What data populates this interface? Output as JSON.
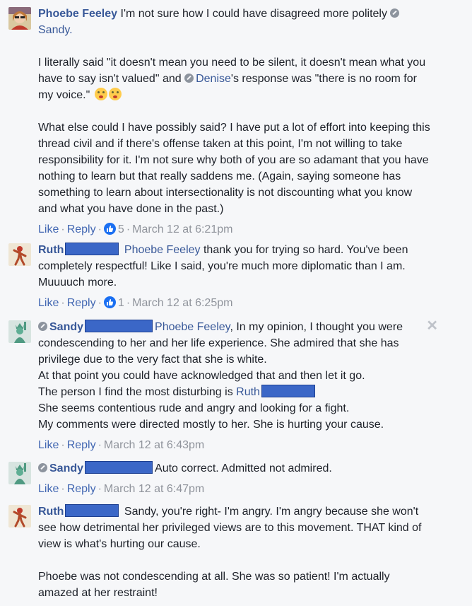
{
  "comments": [
    {
      "author": "Phoebe Feeley",
      "text1": "I'm not sure how I could have disagreed more politely",
      "mention1": "Sandy.",
      "para2_a": "I literally said \"it doesn't mean you need to be silent, it doesn't mean what you have to say isn't valued\" and",
      "mention2": "Denise",
      "para2_b": "'s response was \"there is no room for my voice.\"",
      "para3": "What else could I have possibly said? I have put a lot of effort into keeping this thread civil and if there's offense taken at this point, I'm not willing to take responsibility for it. I'm not sure why both of you are so adamant that you have nothing to learn but that really saddens me. (Again, saying someone has something to learn about intersectionality is not discounting what you know and what you have done in the past.)",
      "like": "Like",
      "reply": "Reply",
      "reactions": "5",
      "time": "March 12 at 6:21pm"
    },
    {
      "author": "Ruth",
      "mention": "Phoebe Feeley",
      "text": "thank you for trying so hard. You've been completely respectful! Like I said, you're much more diplomatic than I am. Muuuuch more.",
      "like": "Like",
      "reply": "Reply",
      "reactions": "1",
      "time": "March 12 at 6:25pm"
    },
    {
      "author": "Sandy",
      "mention": "Phoebe Feeley",
      "text1": ", In my opinion, I thought you were condescending to her and her life experience. She admired that she has privilege due to the very fact that she is white.",
      "line2": "At that point you could have acknowledged that and then let it go.",
      "line3": "The person I find the most disturbing is",
      "mention2": "Ruth",
      "line4": "She seems contentious rude and angry and looking for a fight.",
      "line5": "My comments were directed mostly to her. She is hurting your cause.",
      "like": "Like",
      "reply": "Reply",
      "time": "March 12 at 6:43pm",
      "close": "✕"
    },
    {
      "author": "Sandy",
      "text": "Auto correct. Admitted not admired.",
      "like": "Like",
      "reply": "Reply",
      "time": "March 12 at 6:47pm"
    },
    {
      "author": "Ruth",
      "text1": "Sandy, you're right- I'm angry. I'm angry because she won't see how detrimental her privileged views are to this movement. THAT kind of view is what's hurting our cause.",
      "text2": "Phoebe was not condescending at all. She was so patient! I'm actually amazed at her restraint!"
    }
  ],
  "sep": "·",
  "colors": {
    "link": "#385898",
    "like_blue": "#1a6ff2",
    "redaction": "#3b67c7"
  }
}
